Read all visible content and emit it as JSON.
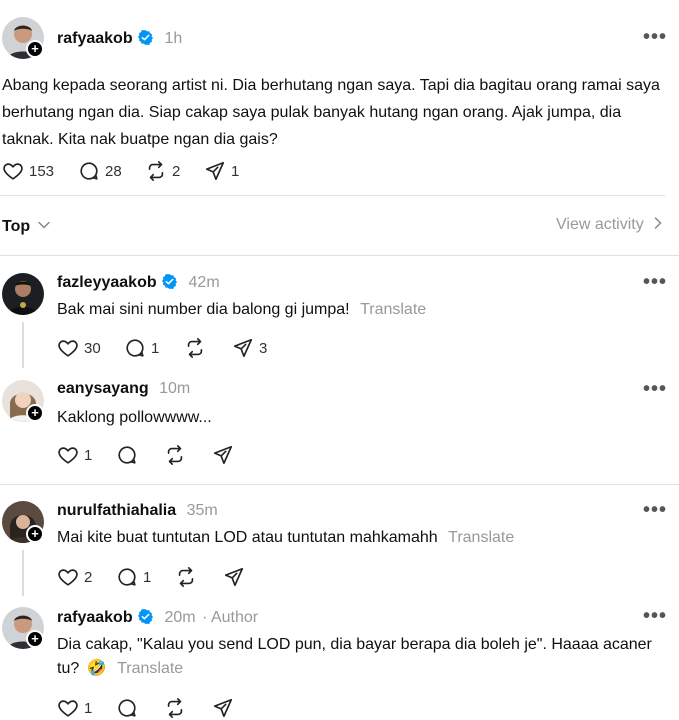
{
  "post": {
    "username": "rafyaakob",
    "time": "1h",
    "text": "Abang kepada seorang artist ni. Dia berhutang ngan saya. Tapi dia bagitau orang ramai saya berhutang ngan dia. Siap cakap saya pulak banyak hutang ngan orang. Ajak jumpa, dia taknak. Kita nak buatpe ngan dia gais?",
    "likes": "153",
    "comments": "28",
    "reposts": "2",
    "shares": "1"
  },
  "filter": {
    "sort_label": "Top",
    "view_activity": "View activity"
  },
  "replies": [
    {
      "username": "fazleyyaakob",
      "time": "42m",
      "text": "Bak mai sini number dia balong gi jumpa!",
      "translate": "Translate",
      "likes": "30",
      "comments": "1",
      "shares": "3"
    },
    {
      "username": "eanysayang",
      "time": "10m",
      "text": "Kaklong pollowwww...",
      "likes": "1"
    },
    {
      "username": "nurulfathiahalia",
      "time": "35m",
      "text": "Mai kite buat tuntutan LOD atau tuntutan mahkamahh",
      "translate": "Translate",
      "likes": "2",
      "comments": "1"
    },
    {
      "username": "rafyaakob",
      "time": "20m",
      "author_tag": "· Author",
      "text_line1": "Dia cakap, \"Kalau you send LOD pun, dia bayar berapa dia boleh je\". Haaaa acaner",
      "text_line2": "tu?",
      "emoji": "🤣",
      "translate": "Translate",
      "likes": "1"
    }
  ],
  "icons": {
    "more": "•••",
    "plus": "+",
    "chevron_down": "⌄",
    "chevron_right": "›"
  },
  "colors": {
    "verified": "#0095f6",
    "muted": "#999999",
    "divider": "#e0e0e0"
  }
}
